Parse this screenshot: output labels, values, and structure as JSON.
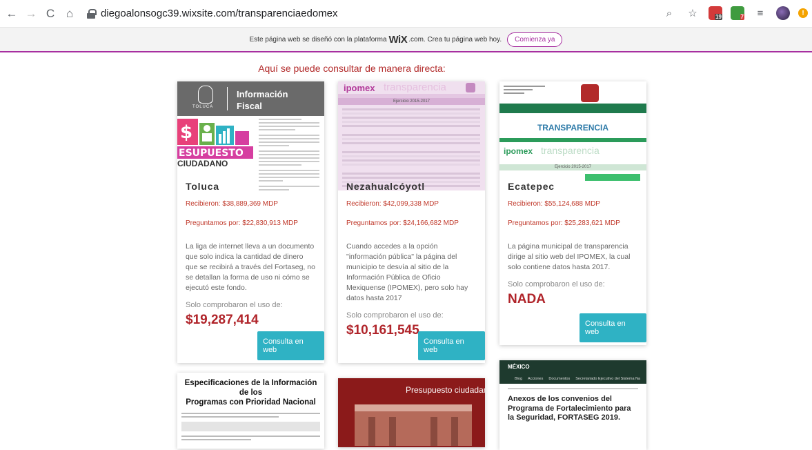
{
  "browser": {
    "url": "diegoalonsogc39.wixsite.com/transparenciaedomex",
    "ext_badge_1": "19",
    "ext_badge_2": "7"
  },
  "wix_banner": {
    "text_before": "Este página web se diseñó con la plataforma",
    "brand": "WiX",
    "text_after": ".com. Crea tu página web hoy.",
    "cta": "Comienza ya"
  },
  "heading": "Aquí se puede consultar de manera directa:",
  "cards": [
    {
      "image_title_1": "Información",
      "image_title_2": "Fiscal",
      "image_brand": "TOLUCA",
      "image_ciudadano": "CIUDADANO",
      "image_esupuesto": "ESUPUESTO",
      "title": "Toluca",
      "recibieron": "Recibieron: $38,889,369 MDP",
      "preguntamos": "Preguntamos por: $22,830,913 MDP",
      "desc": "La liga de internet lleva a un documento que solo indica la cantidad de dinero que se recibirá a través del Fortaseg, no se detallan la forma de uso ni cómo se ejecutó este fondo.",
      "comprobaron": "Solo comprobaron el uso de:",
      "amount": "$19,287,414",
      "button": "Consulta en web"
    },
    {
      "image_brand": "ipomex",
      "image_watermark": "transparencia",
      "image_header": "Ejercicio 2015-2017",
      "title": "Nezahualcóyotl",
      "recibieron": "Recibieron: $42,099,338 MDP",
      "preguntamos": "Preguntamos por: $24,166,682 MDP",
      "desc": "Cuando accedes a la opción \"información pública\" la página del municipio te desvía al sitio de la Información Pública de Oficio Mexiquense (IPOMEX), pero solo hay datos hasta 2017",
      "comprobaron": "Solo comprobaron el uso de:",
      "amount": "$10,161,545",
      "button": "Consulta en web"
    },
    {
      "image_heading": "TRANSPARENCIA",
      "image_brand": "ipomex",
      "image_watermark": "transparencia",
      "image_header": "Ejercicio 2015-2017",
      "title": "Ecatepec",
      "recibieron": "Recibieron: $55,124,688 MDP",
      "preguntamos": "Preguntamos por: $25,283,621 MDP",
      "desc": "La página municipal de transparencia dirige al sitio web del IPOMEX, la cual solo contiene datos hasta 2017.",
      "comprobaron": "Solo comprobaron el uso de:",
      "amount": "NADA",
      "button": "Consulta en web"
    }
  ],
  "lower_cards": [
    {
      "title_1": "Especificaciones de la Información de los",
      "title_2": "Programas con Prioridad Nacional"
    },
    {
      "title": "Presupuesto ciudadano"
    },
    {
      "gov": "MÉXICO",
      "nav": [
        "Blog",
        "Acciones",
        "Documentos",
        "Secretariado Ejecutivo del Sistema Na"
      ],
      "title": "Anexos de los convenios del Programa de Fortalecimiento para la Seguridad, FORTASEG 2019."
    }
  ]
}
